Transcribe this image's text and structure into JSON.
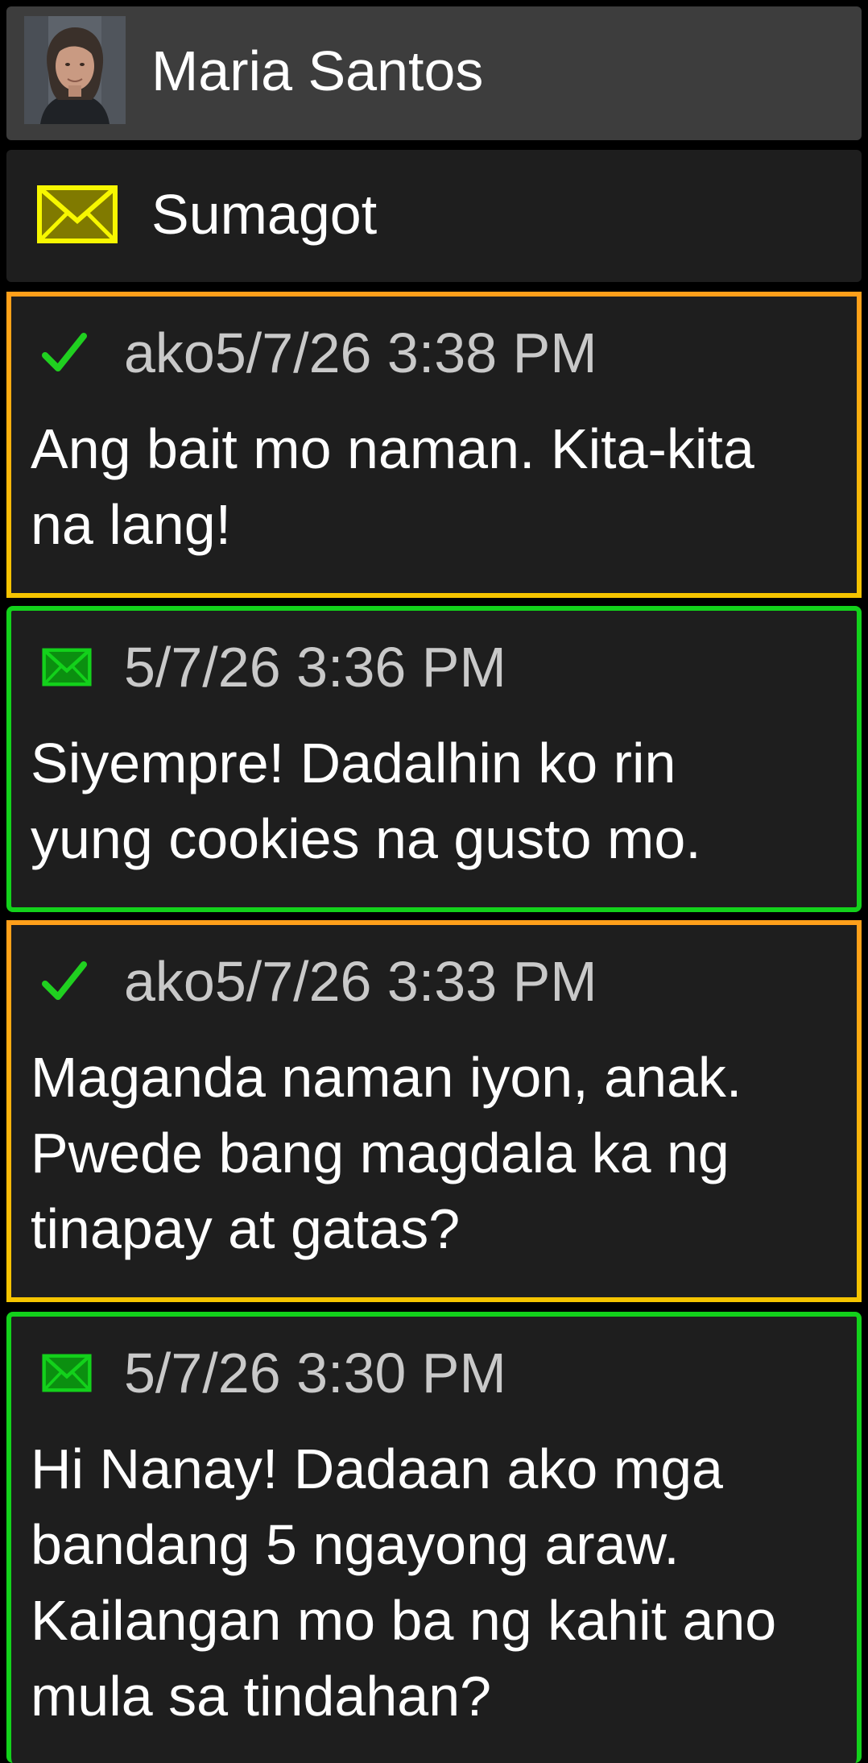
{
  "contact": {
    "name": "Maria Santos",
    "avatar_icon": "person-photo-avatar"
  },
  "reply_bar": {
    "icon": "envelope-icon",
    "label": "Sumagot",
    "icon_color": "#f7f700"
  },
  "colors": {
    "sent_border": "#f5a623",
    "received_border": "#13d11b",
    "check_color": "#20d020",
    "envelope_green": "#13d11b"
  },
  "messages": [
    {
      "direction": "sent",
      "status_icon": "check-icon",
      "meta": "ako5/7/26 3:38 PM",
      "text": "Ang bait mo naman. Kita-kita\nna lang!"
    },
    {
      "direction": "received",
      "status_icon": "envelope-icon",
      "meta": "5/7/26 3:36 PM",
      "text": "Siyempre! Dadalhin ko rin\nyung cookies na gusto mo."
    },
    {
      "direction": "sent",
      "status_icon": "check-icon",
      "meta": "ako5/7/26 3:33 PM",
      "text": "Maganda naman iyon, anak.\nPwede bang magdala ka ng\ntinapay at gatas?"
    },
    {
      "direction": "received",
      "status_icon": "envelope-icon",
      "meta": "5/7/26 3:30 PM",
      "text": "Hi Nanay! Dadaan ako mga\nbandang 5 ngayong araw.\nKailangan mo ba ng kahit ano\nmula sa tindahan?"
    }
  ]
}
